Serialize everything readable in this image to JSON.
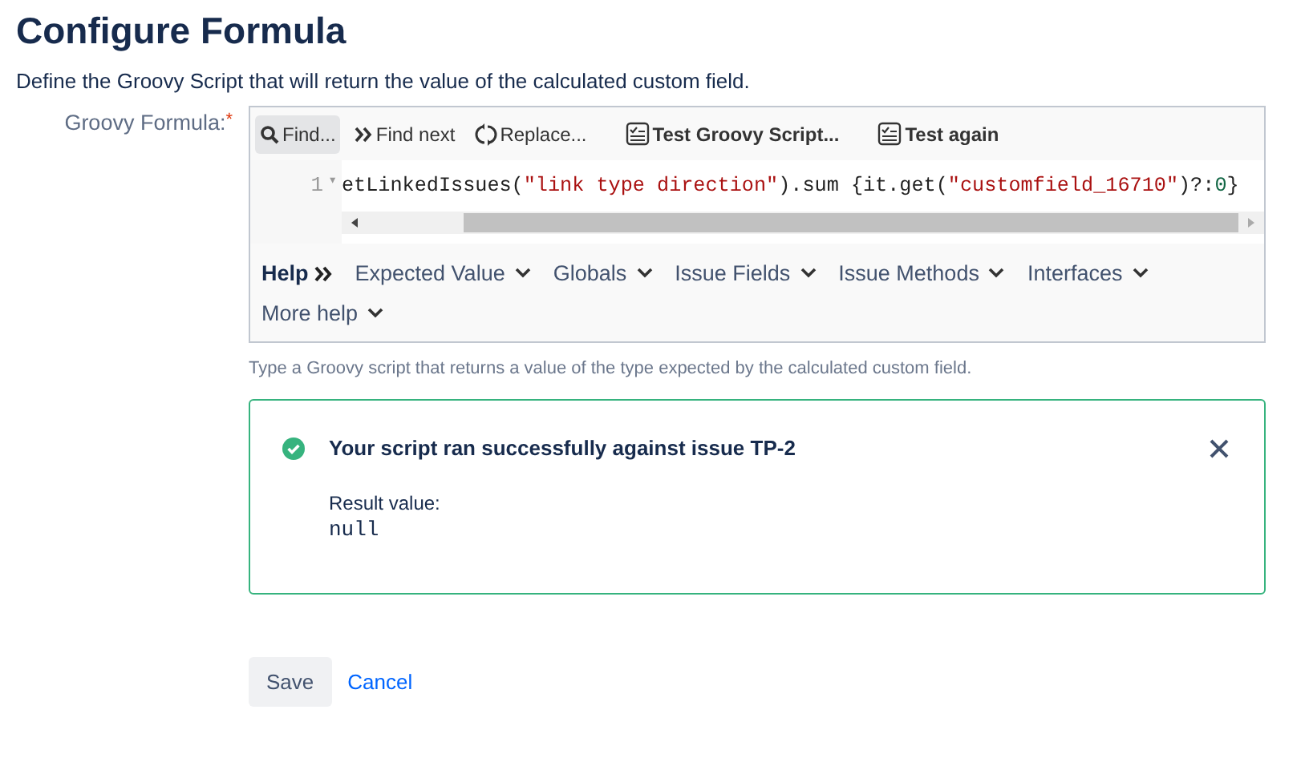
{
  "page": {
    "title": "Configure Formula",
    "description": "Define the Groovy Script that will return the value of the calculated custom field."
  },
  "field": {
    "label": "Groovy Formula:",
    "required_mark": "*",
    "hint": "Type a Groovy script that returns a value of the type expected by the calculated custom field."
  },
  "toolbar": [
    {
      "label": "Find...",
      "kind": "search",
      "selected": true
    },
    {
      "label": "Find next",
      "kind": "next",
      "selected": false
    },
    {
      "label": "Replace...",
      "kind": "replace",
      "selected": false
    },
    {
      "label": "Test Groovy Script...",
      "kind": "test",
      "selected": false
    },
    {
      "label": "Test again",
      "kind": "test",
      "selected": false
    }
  ],
  "editor": {
    "line_number": "1",
    "fold_mark": "▾",
    "tokens": [
      {
        "text": "etLinkedIssues(",
        "kind": "plain"
      },
      {
        "text": "\"link type direction\"",
        "kind": "string"
      },
      {
        "text": ").sum {it.get(",
        "kind": "plain"
      },
      {
        "text": "\"customfield_16710\"",
        "kind": "string"
      },
      {
        "text": ")?:",
        "kind": "plain"
      },
      {
        "text": "0",
        "kind": "number"
      },
      {
        "text": "}",
        "kind": "plain"
      }
    ]
  },
  "help_bar": {
    "label": "Help",
    "menus": [
      "Expected Value",
      "Globals",
      "Issue Fields",
      "Issue Methods",
      "Interfaces",
      "More help"
    ]
  },
  "alert": {
    "kind": "success",
    "title": "Your script ran successfully against issue TP-2",
    "result_label": "Result value:",
    "result": "null"
  },
  "buttons": [
    {
      "label": "Save",
      "kind": "button"
    },
    {
      "label": "Cancel",
      "kind": "link"
    }
  ]
}
